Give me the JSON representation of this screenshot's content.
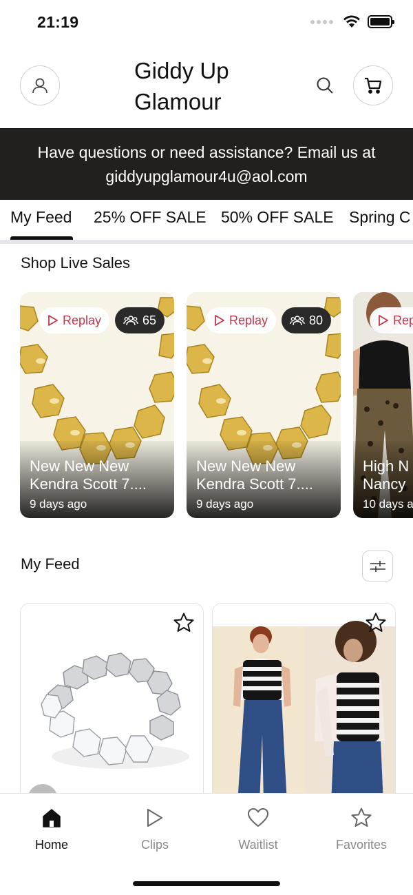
{
  "status_bar": {
    "time": "21:19"
  },
  "header": {
    "brand": "Giddy Up Glamour"
  },
  "banner": {
    "line1": "Have questions or need assistance? Email us at",
    "line2": "giddyupglamour4u@aol.com"
  },
  "tabs": [
    {
      "label": "My Feed",
      "active": true
    },
    {
      "label": "25% OFF SALE"
    },
    {
      "label": "50% OFF SALE"
    },
    {
      "label": "Spring C"
    }
  ],
  "live_sales": {
    "title": "Shop Live Sales",
    "items": [
      {
        "badge": "Replay",
        "viewers": "65",
        "title_line1": "New New New",
        "title_line2": "Kendra Scott 7....",
        "date": "9 days ago"
      },
      {
        "badge": "Replay",
        "viewers": "80",
        "title_line1": "New New New",
        "title_line2": "Kendra Scott 7....",
        "date": "9 days ago"
      },
      {
        "badge": "Rep",
        "title_line1": "High N",
        "title_line2": "Nancy",
        "date": "10 days a"
      }
    ]
  },
  "feed": {
    "title": "My Feed"
  },
  "bottom_nav": [
    {
      "label": "Home",
      "icon": "home-icon",
      "active": true
    },
    {
      "label": "Clips",
      "icon": "play-icon"
    },
    {
      "label": "Waitlist",
      "icon": "heart-icon"
    },
    {
      "label": "Favorites",
      "icon": "star-icon"
    }
  ],
  "colors": {
    "banner_bg": "#221f1f",
    "replay_red": "#c8344c",
    "gold": "#d9b64a"
  }
}
